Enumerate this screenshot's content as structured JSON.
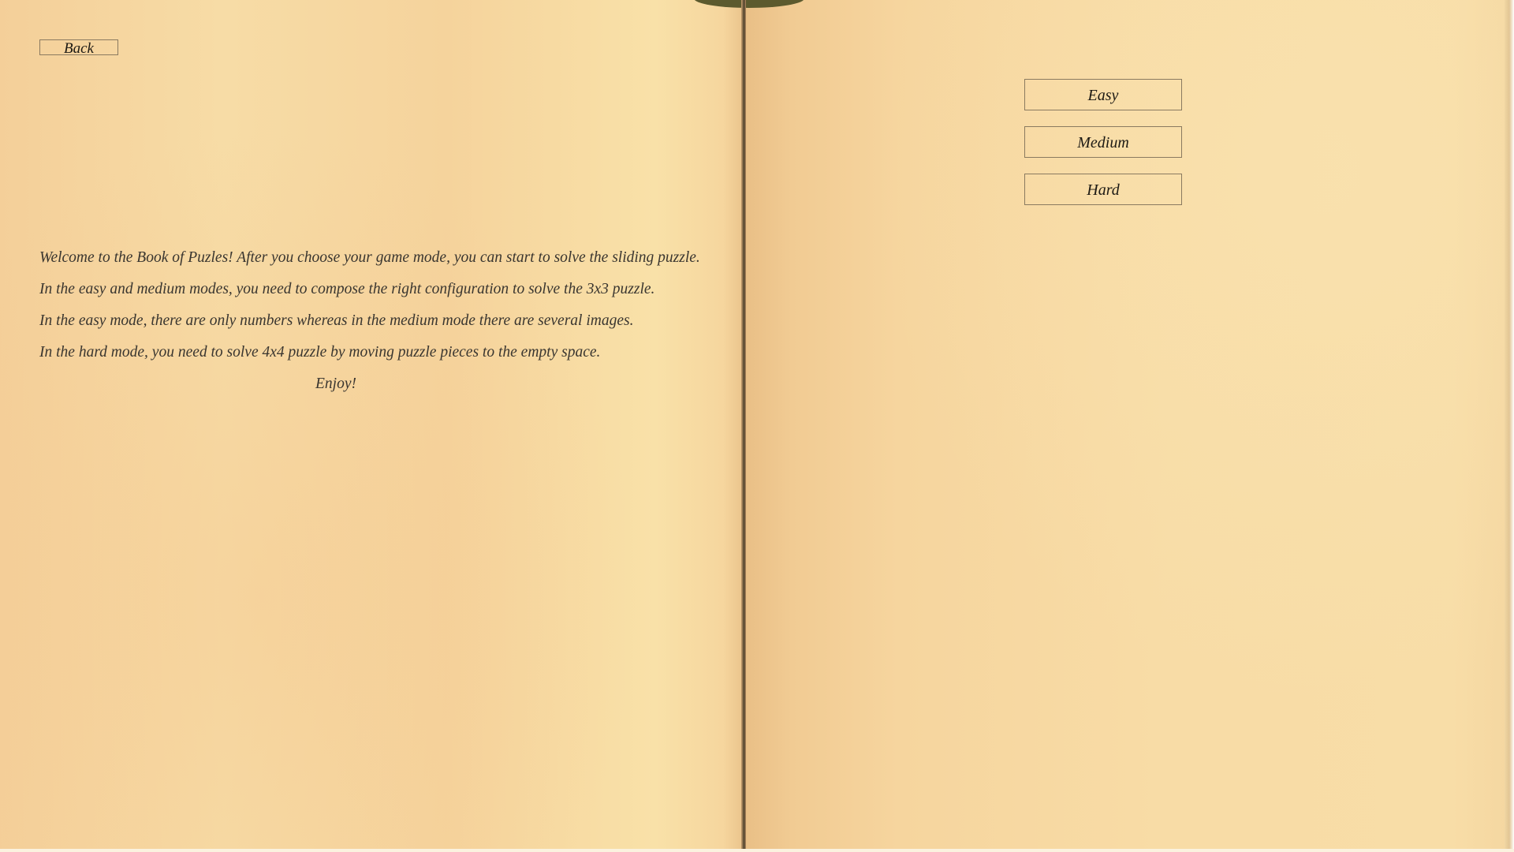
{
  "navigation": {
    "back_label": "Back"
  },
  "modes": {
    "easy_label": "Easy",
    "medium_label": "Medium",
    "hard_label": "Hard"
  },
  "intro": {
    "lines": [
      "Welcome to the Book of Puzles! After you choose your game mode, you can start to solve the sliding puzzle.",
      "In the easy and medium modes, you need to compose the right configuration to solve the 3x3 puzzle.",
      "In the easy mode, there are only numbers whereas in the medium mode there are several images.",
      "In the hard mode, you need to solve 4x4 puzzle by moving puzzle pieces to the empty space."
    ],
    "closing": "Enjoy!"
  },
  "colors": {
    "page": "#f6dca4",
    "spine": "#4a3c28",
    "text": "#3a3630",
    "button_border": "#8a7a60"
  }
}
